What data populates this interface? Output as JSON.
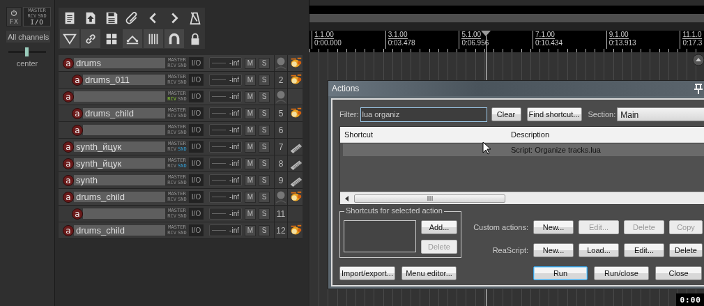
{
  "master": {
    "fx": "FX",
    "routing": {
      "master": "MASTER",
      "rcv": "RCV",
      "snd": "SND",
      "io": "I/O"
    },
    "channels": "All channels",
    "pan": {
      "level": 0.5,
      "reading": "center"
    }
  },
  "toolbar": [
    {
      "kind": "document",
      "on": false
    },
    {
      "kind": "import",
      "on": false
    },
    {
      "kind": "save",
      "on": false
    },
    {
      "kind": "paperclip",
      "on": false
    },
    {
      "kind": "back",
      "on": false
    },
    {
      "kind": "forward",
      "on": false
    },
    {
      "kind": "metronome",
      "on": false
    },
    {
      "kind": "filter",
      "on": true
    },
    {
      "kind": "link",
      "on": true
    },
    {
      "kind": "grid",
      "on": false
    },
    {
      "kind": "envelope",
      "on": true
    },
    {
      "kind": "bars",
      "on": true
    },
    {
      "kind": "magnet",
      "on": true
    },
    {
      "kind": "lock",
      "on": false
    }
  ],
  "tracks": [
    {
      "arm": "a",
      "name": "drums",
      "folder": true,
      "receives": false,
      "sends": false,
      "master": "MASTER",
      "rcv": "RCV",
      "snd": "SND",
      "io": "I/O",
      "volume": "-inf",
      "mute": "M",
      "solo": "S",
      "kind": "drums",
      "children": [
        {
          "arm": "a",
          "name": "drums_011",
          "number": "2",
          "folder": false,
          "receives": false,
          "sends": false,
          "master": "MASTER",
          "rcv": "RCV",
          "snd": "SND",
          "io": "I/O",
          "volume": "-inf",
          "mute": "M",
          "solo": "S",
          "kind": "drums"
        }
      ]
    },
    {
      "arm": "a",
      "folder": true,
      "receives": true,
      "sends": false,
      "master": "MASTER",
      "rcv": "RCV",
      "snd": "SND",
      "io": "I/O",
      "volume": "-inf",
      "mute": "M",
      "solo": "S",
      "children": [
        {
          "arm": "a",
          "name": "drums_child",
          "number": "5",
          "folder": false,
          "receives": false,
          "sends": false,
          "master": "MASTER",
          "rcv": "RCV",
          "snd": "SND",
          "io": "I/O",
          "volume": "-inf",
          "mute": "M",
          "solo": "S",
          "kind": "drums"
        },
        {
          "arm": "a",
          "number": "6",
          "folder": false,
          "receives": false,
          "sends": false,
          "master": "MASTER",
          "rcv": "RCV",
          "snd": "SND",
          "io": "I/O",
          "volume": "-inf",
          "mute": "M",
          "solo": "S"
        }
      ]
    },
    {
      "arm": "a",
      "name": "synth_йцук",
      "number": "7",
      "folder": false,
      "receives": false,
      "sends": true,
      "master": "MASTER",
      "rcv": "RCV",
      "snd": "SND",
      "io": "I/O",
      "volume": "-inf",
      "mute": "M",
      "solo": "S",
      "kind": "synth"
    },
    {
      "arm": "a",
      "name": "synth_йцук",
      "number": "8",
      "folder": false,
      "receives": false,
      "sends": true,
      "master": "MASTER",
      "rcv": "RCV",
      "snd": "SND",
      "io": "I/O",
      "volume": "-inf",
      "mute": "M",
      "solo": "S",
      "kind": "synth"
    },
    {
      "arm": "a",
      "name": "synth",
      "number": "9",
      "folder": false,
      "receives": false,
      "sends": false,
      "master": "MASTER",
      "rcv": "RCV",
      "snd": "SND",
      "io": "I/O",
      "volume": "-inf",
      "mute": "M",
      "solo": "S",
      "kind": "synth"
    },
    {
      "arm": "a",
      "name": "drums_child",
      "folder": true,
      "receives": false,
      "sends": false,
      "master": "MASTER",
      "rcv": "RCV",
      "snd": "SND",
      "io": "I/O",
      "volume": "-inf",
      "mute": "M",
      "solo": "S",
      "kind": "drums",
      "children": [
        {
          "arm": "a",
          "number": "11",
          "folder": false,
          "receives": false,
          "sends": false,
          "master": "MASTER",
          "rcv": "RCV",
          "snd": "SND",
          "io": "I/O",
          "volume": "-inf",
          "mute": "M",
          "solo": "S"
        }
      ]
    },
    {
      "arm": "a",
      "name": "drums_child",
      "number": "12",
      "folder": false,
      "receives": false,
      "sends": false,
      "master": "MASTER",
      "rcv": "RCV",
      "snd": "SND",
      "io": "I/O",
      "volume": "-inf",
      "mute": "M",
      "solo": "S",
      "kind": "drums"
    }
  ],
  "ruler": [
    {
      "bar": "1.1.00",
      "time": "0:00.000"
    },
    {
      "bar": "3.1.00",
      "time": "0:03.478"
    },
    {
      "bar": "5.1.00",
      "time": "0:06.956"
    },
    {
      "bar": "7.1.00",
      "time": "0:10.434"
    },
    {
      "bar": "9.1.00",
      "time": "0:13.913"
    },
    {
      "bar": "11.1.0",
      "time": "0:17.3"
    }
  ],
  "actions_dialog": {
    "title": "Actions",
    "filter": {
      "label": "Filter:",
      "value": "lua organiz"
    },
    "filter_buttons": [
      {
        "label": "Clear"
      },
      {
        "label": "Find shortcut..."
      }
    ],
    "section": {
      "label": "Section:",
      "value": "Main"
    },
    "table": {
      "columns": [
        "Shortcut",
        "Description"
      ],
      "rows": [
        {
          "description": "Script: Organize tracks.lua",
          "selected": true
        }
      ]
    },
    "shortcuts_group": {
      "title": "Shortcuts for selected action",
      "buttons": [
        {
          "label": "Add...",
          "disabled": false
        },
        {
          "label": "Delete",
          "disabled": true
        }
      ]
    },
    "button_rows": [
      {
        "label": "Custom actions:",
        "buttons": [
          {
            "label": "New...",
            "disabled": false
          },
          {
            "label": "Edit...",
            "disabled": true
          },
          {
            "label": "Delete",
            "disabled": true
          },
          {
            "label": "Copy",
            "disabled": true
          }
        ]
      },
      {
        "label": "ReaScript:",
        "buttons": [
          {
            "label": "New...",
            "disabled": false
          },
          {
            "label": "Load...",
            "disabled": false
          },
          {
            "label": "Edit...",
            "disabled": false
          },
          {
            "label": "Delete",
            "disabled": false
          }
        ]
      }
    ],
    "footer_left": [
      {
        "label": "Import/export..."
      },
      {
        "label": "Menu editor..."
      }
    ],
    "footer_right": [
      {
        "label": "Run",
        "focused": true
      },
      {
        "label": "Run/close",
        "focused": false
      },
      {
        "label": "Close",
        "focused": false
      }
    ]
  },
  "timecode": "0:00"
}
